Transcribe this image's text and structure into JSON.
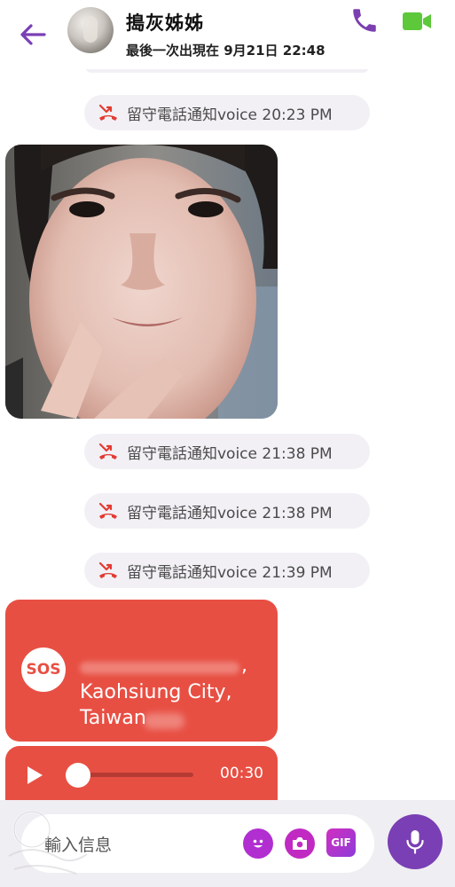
{
  "header": {
    "contact_name": "搗灰姊姊",
    "last_seen": "最後一次出現在 9月21日 22:48"
  },
  "colors": {
    "accent_purple": "#7a3fb4",
    "call_purple": "#7b3fb0",
    "video_green": "#5ec83b",
    "missed_red": "#e33a32",
    "sos_red": "#e84f43",
    "pill_bg": "#f2f0f5"
  },
  "icons": {
    "back": "back-arrow-icon",
    "call": "phone-icon",
    "video": "video-camera-icon",
    "missed": "missed-call-icon",
    "play": "play-icon",
    "emoji": "emoji-icon",
    "camera": "camera-icon",
    "mic": "microphone-icon"
  },
  "messages": [
    {
      "type": "missed_call",
      "text": "留守電話通知voice 20:23 PM"
    },
    {
      "type": "photo"
    },
    {
      "type": "missed_call",
      "text": "留守電話通知voice 21:38 PM"
    },
    {
      "type": "missed_call",
      "text": "留守電話通知voice 21:38 PM"
    },
    {
      "type": "missed_call",
      "text": "留守電話通知voice 21:39 PM"
    }
  ],
  "sos": {
    "badge": "SOS",
    "line1_suffix": ",",
    "city": "Kaohsiung City,",
    "country": "Taiwan"
  },
  "voice_message": {
    "duration": "00:30",
    "progress": 0.0
  },
  "composer": {
    "placeholder": "輸入信息",
    "gif_label": "GIF"
  }
}
